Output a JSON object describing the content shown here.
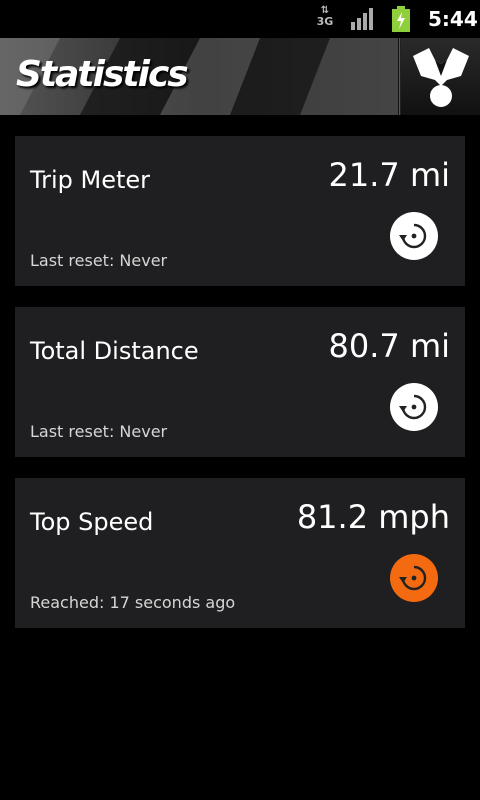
{
  "status_bar": {
    "network": "3G",
    "time": "5:44"
  },
  "action_bar": {
    "title": "Statistics",
    "menu_icon": "driver-icon"
  },
  "cards": [
    {
      "label": "Trip Meter",
      "value": "21.7 mi",
      "sub": "Last reset: Never",
      "button_color": "#ffffff"
    },
    {
      "label": "Total Distance",
      "value": "80.7 mi",
      "sub": "Last reset: Never",
      "button_color": "#ffffff"
    },
    {
      "label": "Top Speed",
      "value": "81.2 mph",
      "sub": "Reached: 17 seconds ago",
      "button_color": "#f36a10"
    }
  ]
}
